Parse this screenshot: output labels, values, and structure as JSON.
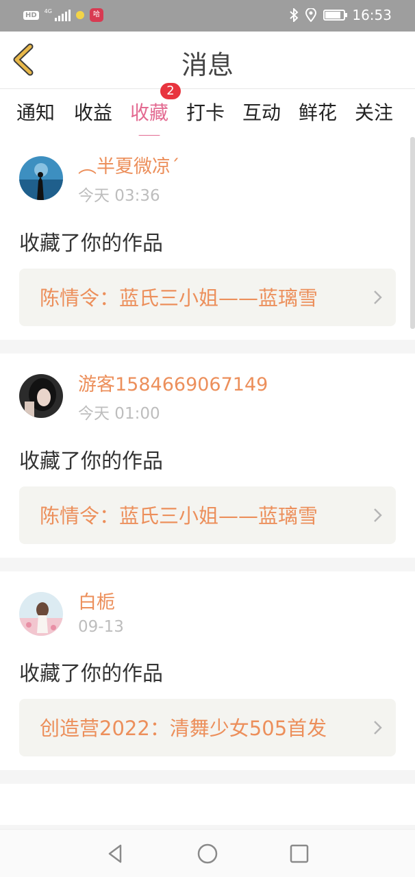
{
  "status_bar": {
    "hd": "HD",
    "network": "4G",
    "app_badge": "哈",
    "time": "16:53",
    "battery_level": 0.85
  },
  "header": {
    "title": "消息"
  },
  "tabs": [
    {
      "label": "通知"
    },
    {
      "label": "收益"
    },
    {
      "label": "收藏",
      "active": true,
      "badge": "2"
    },
    {
      "label": "打卡"
    },
    {
      "label": "互动"
    },
    {
      "label": "鲜花"
    },
    {
      "label": "关注"
    }
  ],
  "messages": [
    {
      "user": "︵半夏微凉´",
      "time": "今天 03:36",
      "action": "收藏了你的作品",
      "work": "陈情令：蓝氏三小姐——蓝璃雪"
    },
    {
      "user": "游客1584669067149",
      "time": "今天 01:00",
      "action": "收藏了你的作品",
      "work": "陈情令：蓝氏三小姐——蓝璃雪"
    },
    {
      "user": "白栀",
      "time": "09-13",
      "action": "收藏了你的作品",
      "work": "创造营2022：清舞少女505首发"
    }
  ],
  "colors": {
    "accent_pink": "#e36a91",
    "username_orange": "#ec8f5b",
    "badge_red": "#e8343e",
    "back_arrow": "#e8b84a"
  }
}
